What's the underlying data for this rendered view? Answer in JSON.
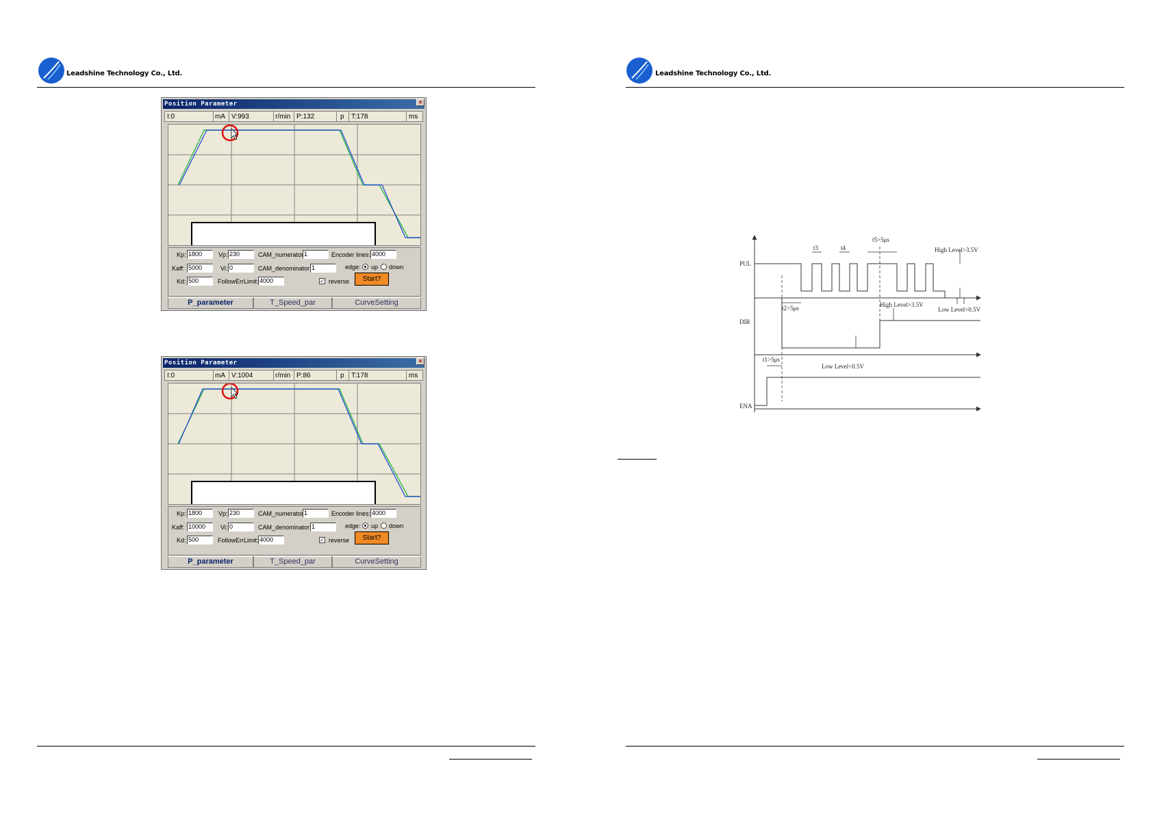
{
  "header": {
    "left_logo_text": "Leadshine Technology Co., Ltd.",
    "right_logo_text": "Leadshine Technology Co., Ltd."
  },
  "windows": [
    {
      "title": "Position Parameter",
      "status": {
        "i": "I:0",
        "i_unit": "mA",
        "v": "V:993",
        "v_unit": "r/min",
        "p": "P:132",
        "p_unit": "p",
        "t": "T:178",
        "t_unit": "ms"
      },
      "params": {
        "kp_label": "Kp:",
        "kp": "1800",
        "kaff_label": "Kaff:",
        "kaff": "5000",
        "kd_label": "Kd:",
        "kd": "500",
        "vp_label": "Vp:",
        "vp": "230",
        "vi_label": "Vi:",
        "vi": "0",
        "follow_label": "FollowErrLimit:",
        "follow": "4000",
        "cam_num_label": "CAM_numerator:",
        "cam_num": "1",
        "cam_den_label": "CAM_denominator:",
        "cam_den": "1",
        "enc_label": "Encoder lines:",
        "enc": "4000",
        "edge_label": "edge:",
        "up_label": "up",
        "down_label": "down",
        "reverse_label": "reverse",
        "start_label": "Start?"
      },
      "tabs": [
        "P_parameter",
        "T_Speed_par",
        "CurveSetting"
      ]
    },
    {
      "title": "Position Parameter",
      "status": {
        "i": "I:0",
        "i_unit": "mA",
        "v": "V:1004",
        "v_unit": "r/min",
        "p": "P:86",
        "p_unit": "p",
        "t": "T:178",
        "t_unit": "ms"
      },
      "params": {
        "kp_label": "Kp:",
        "kp": "1800",
        "kaff_label": "Kaff:",
        "kaff": "10000",
        "kd_label": "Kd:",
        "kd": "500",
        "vp_label": "Vp:",
        "vp": "230",
        "vi_label": "Vi:",
        "vi": "0",
        "follow_label": "FollowErrLimit:",
        "follow": "4000",
        "cam_num_label": "CAM_numerator:",
        "cam_num": "1",
        "cam_den_label": "CAM_denominator:",
        "cam_den": "1",
        "enc_label": "Encoder lines:",
        "enc": "4000",
        "edge_label": "edge:",
        "up_label": "up",
        "down_label": "down",
        "reverse_label": "reverse",
        "start_label": "Start?"
      },
      "tabs": [
        "P_parameter",
        "T_Speed_par",
        "CurveSetting"
      ]
    }
  ],
  "timing": {
    "pul": "PUL",
    "dir": "DIR",
    "ena": "ENA",
    "t3": "t3",
    "t4": "t4",
    "t5": "t5>5μs",
    "t2": "t2>5μs",
    "t1": "t1>5μs",
    "high1": "High Level>3.5V",
    "high2": "High Level>3.5V",
    "low1": "Low Level<0.5V",
    "low2": "Low Level<0.5V"
  }
}
